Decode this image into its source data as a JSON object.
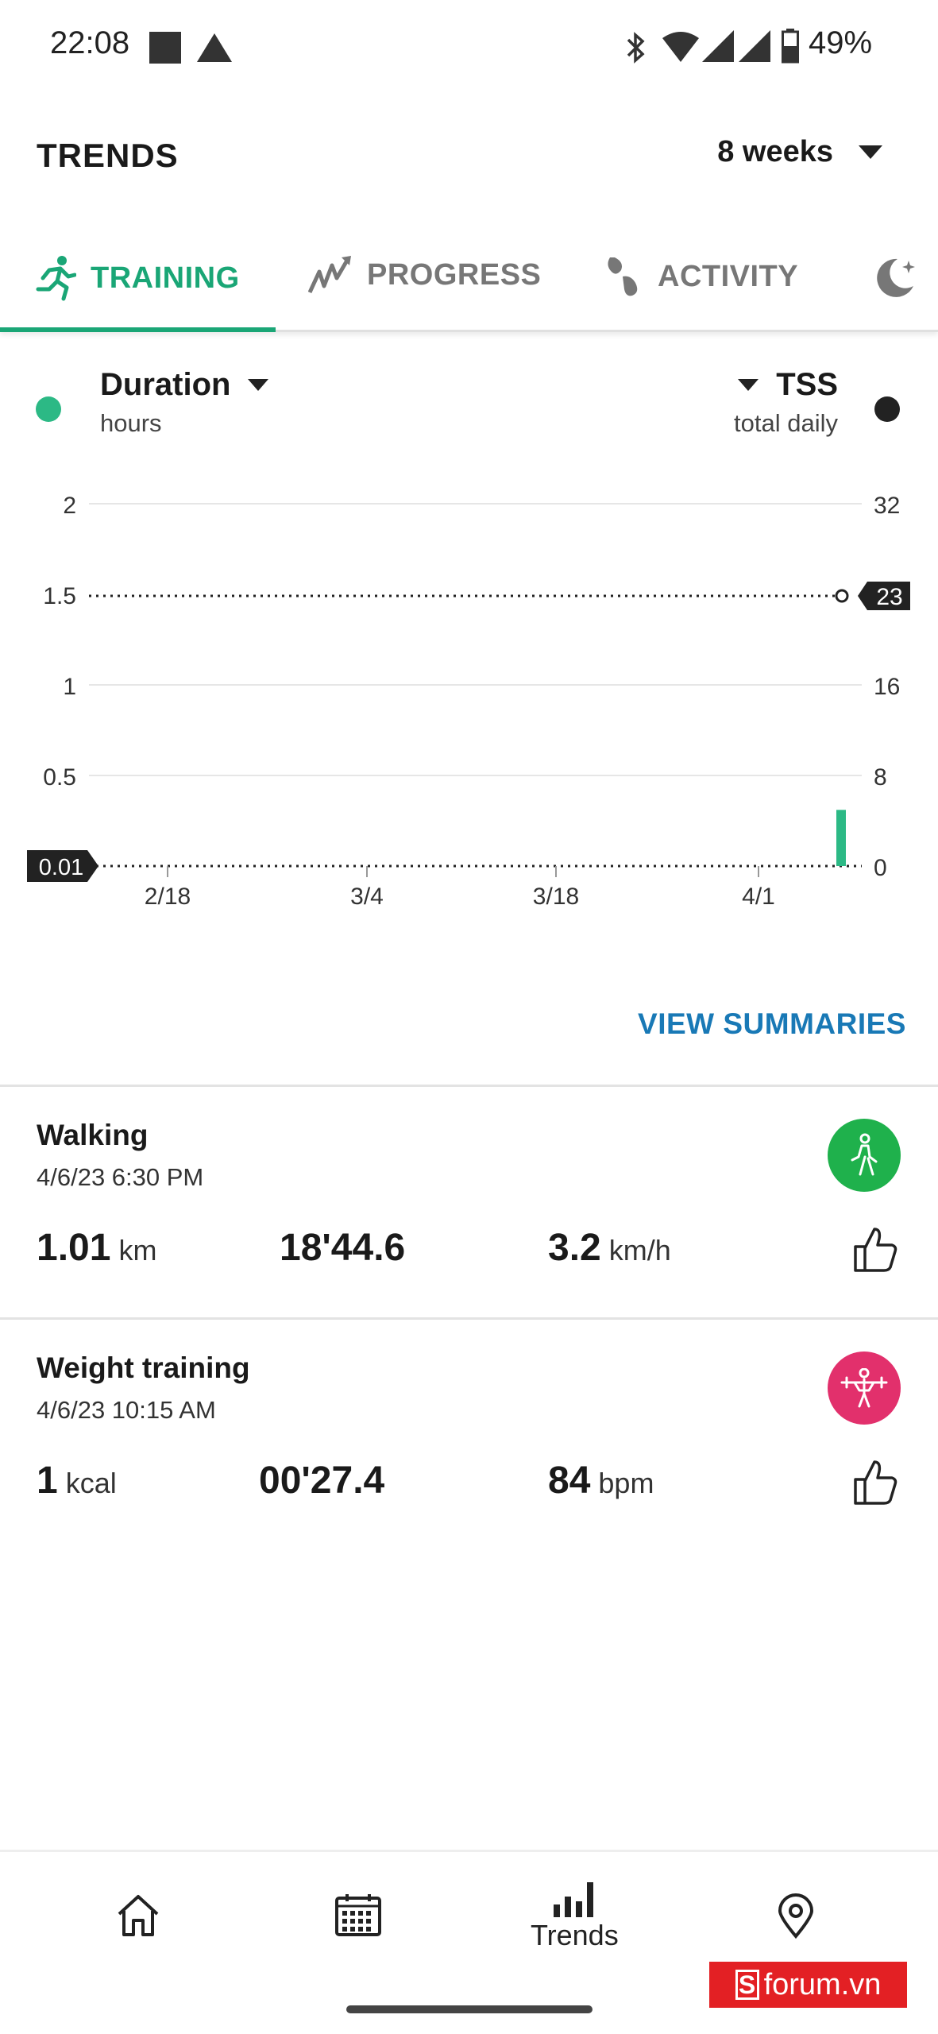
{
  "status_bar": {
    "time": "22:08",
    "battery": "49%"
  },
  "header": {
    "title": "TRENDS",
    "range": "8 weeks"
  },
  "tabs": [
    {
      "label": "TRAINING",
      "icon": "running-icon",
      "active": true
    },
    {
      "label": "PROGRESS",
      "icon": "progress-icon",
      "active": false
    },
    {
      "label": "ACTIVITY",
      "icon": "footsteps-icon",
      "active": false
    },
    {
      "label": "",
      "icon": "sleep-moon-icon",
      "active": false
    }
  ],
  "metrics": {
    "left": {
      "title": "Duration",
      "unit": "hours",
      "color": "#2cb985"
    },
    "right": {
      "title": "TSS",
      "unit": "total daily",
      "color": "#222222"
    }
  },
  "chart_data": {
    "type": "bar",
    "x_tick_labels": [
      "2/18",
      "3/4",
      "3/18",
      "4/1"
    ],
    "y_left_ticks": [
      "2",
      "1.5",
      "1",
      "0.5"
    ],
    "y_right_ticks": [
      "32",
      "23",
      "16",
      "8",
      "0"
    ],
    "y_left_range": [
      0,
      2
    ],
    "y_right_range": [
      0,
      32
    ],
    "series": [
      {
        "name": "Duration",
        "axis": "left",
        "values": [
          0.31
        ],
        "color": "#2cb985"
      },
      {
        "name": "TSS",
        "axis": "right",
        "values": [
          23
        ],
        "color": "#222222"
      }
    ],
    "markers": {
      "duration_average": "0.01",
      "tss_current": "23"
    },
    "grid": true
  },
  "view_summaries": "VIEW SUMMARIES",
  "activities": [
    {
      "title": "Walking",
      "time": "4/6/23 6:30 PM",
      "icon": "walking-icon",
      "icon_color": "#1fb14c",
      "stats": [
        {
          "value": "1.01",
          "unit": "km"
        },
        {
          "value": "18'44.6",
          "unit": ""
        },
        {
          "value": "3.2",
          "unit": "km/h"
        }
      ]
    },
    {
      "title": "Weight training",
      "time": "4/6/23 10:15 AM",
      "icon": "weightlifting-icon",
      "icon_color": "#e2306c",
      "stats": [
        {
          "value": "1",
          "unit": "kcal"
        },
        {
          "value": "00'27.4",
          "unit": ""
        },
        {
          "value": "84",
          "unit": "bpm"
        }
      ]
    }
  ],
  "bottom_nav": {
    "items": [
      {
        "icon": "home-icon",
        "label": ""
      },
      {
        "icon": "calendar-icon",
        "label": ""
      },
      {
        "icon": "trends-icon",
        "label": "Trends"
      },
      {
        "icon": "map-pin-icon",
        "label": ""
      }
    ]
  },
  "watermark": "forum.vn"
}
